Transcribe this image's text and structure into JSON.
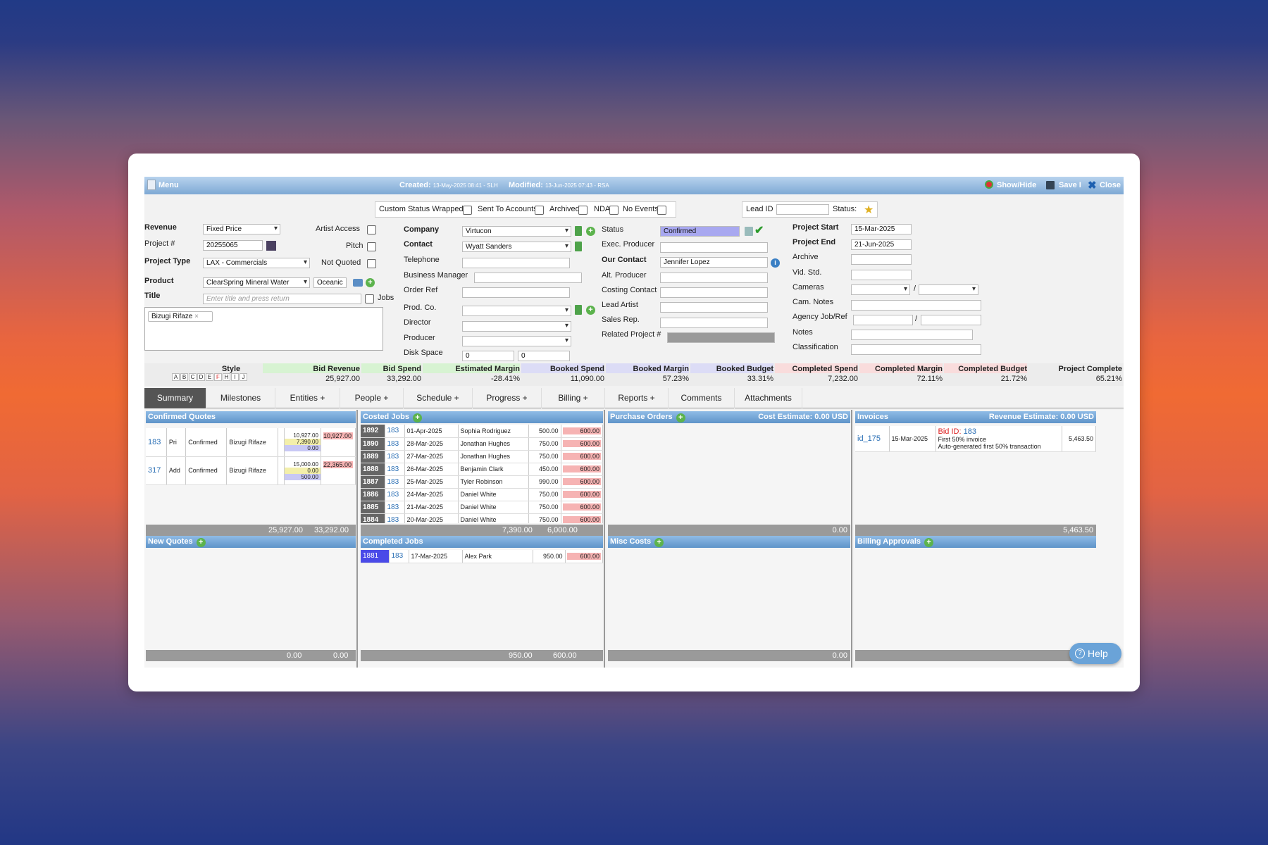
{
  "topbar": {
    "menu": "Menu",
    "created_label": "Created:",
    "created_value": "13-May-2025 08:41 - SLH",
    "modified_label": "Modified:",
    "modified_value": "13-Jun-2025 07:43 - RSA",
    "showhide": "Show/Hide",
    "save": "Save I",
    "close": "Close"
  },
  "flags": {
    "custom_status_wrapped": "Custom Status Wrapped",
    "sent_to_accounts": "Sent To Accounts",
    "archived": "Archived",
    "nda": "NDA",
    "no_events": "No Events",
    "lead_id": "Lead ID",
    "status": "Status:"
  },
  "left": {
    "revenue_label": "Revenue",
    "revenue_value": "Fixed Price",
    "project_label": "Project #",
    "project_value": "20255065",
    "project_type_label": "Project Type",
    "project_type_value": "LAX - Commercials",
    "product_label": "Product",
    "product_value": "ClearSpring Mineral Water",
    "product_tag": "Oceanic",
    "title_label": "Title",
    "title_placeholder": "Enter title and press return",
    "jobs": "Jobs",
    "tag": "Bizugi Rifaze",
    "artist_access": "Artist Access",
    "pitch": "Pitch",
    "not_quoted": "Not Quoted"
  },
  "mid": {
    "company_label": "Company",
    "company_value": "Virtucon",
    "contact_label": "Contact",
    "contact_value": "Wyatt Sanders",
    "telephone": "Telephone",
    "business_manager": "Business Manager",
    "order_ref": "Order Ref",
    "prod_co": "Prod. Co.",
    "director": "Director",
    "producer": "Producer",
    "disk_space": "Disk Space",
    "disk_a": "0",
    "disk_b": "0"
  },
  "right": {
    "status_label": "Status",
    "status_value": "Confirmed",
    "exec_producer": "Exec. Producer",
    "our_contact_label": "Our Contact",
    "our_contact_value": "Jennifer Lopez",
    "alt_producer": "Alt. Producer",
    "costing_contact": "Costing Contact",
    "lead_artist": "Lead Artist",
    "sales_rep": "Sales Rep.",
    "related_project": "Related Project #"
  },
  "far": {
    "project_start_label": "Project Start",
    "project_start_value": "15-Mar-2025",
    "project_end_label": "Project End",
    "project_end_value": "21-Jun-2025",
    "archive": "Archive",
    "vid_std": "Vid. Std.",
    "cameras": "Cameras",
    "cam_notes": "Cam. Notes",
    "agency": "Agency Job/Ref",
    "notes": "Notes",
    "classification": "Classification",
    "slash": "/"
  },
  "stats": {
    "style": "Style",
    "style_letters": [
      "A",
      "B",
      "C",
      "D",
      "E",
      "F",
      "H",
      "I",
      "J"
    ],
    "items": [
      {
        "label": "Bid Revenue",
        "value": "25,927.00",
        "color": "#d7f3d2"
      },
      {
        "label": "Bid Spend",
        "value": "33,292.00",
        "color": "#d7f3d2"
      },
      {
        "label": "Estimated Margin",
        "value": "-28.41%",
        "color": "#d7f3d2"
      },
      {
        "label": "Booked Spend",
        "value": "11,090.00",
        "color": "#dcdcf6"
      },
      {
        "label": "Booked Margin",
        "value": "57.23%",
        "color": "#dcdcf6"
      },
      {
        "label": "Booked Budget",
        "value": "33.31%",
        "color": "#dcdcf6"
      },
      {
        "label": "Completed Spend",
        "value": "7,232.00",
        "color": "#f9dcdc"
      },
      {
        "label": "Completed Margin",
        "value": "72.11%",
        "color": "#f9dcdc"
      },
      {
        "label": "Completed Budget",
        "value": "21.72%",
        "color": "#f9dcdc"
      },
      {
        "label": "Project Complete",
        "value": "65.21%",
        "color": "#ececec"
      }
    ]
  },
  "tabs": [
    "Summary",
    "Milestones",
    "Entities +",
    "People +",
    "Schedule +",
    "Progress +",
    "Billing +",
    "Reports +",
    "Comments",
    "Attachments"
  ],
  "quotes": {
    "title": "Confirmed Quotes",
    "rows": [
      {
        "id": "183",
        "type": "Pri",
        "status": "Confirmed",
        "client": "Bizugi Rifaze",
        "a": "10,927.00",
        "b": "7,390.00",
        "c": "0.00",
        "d": "10,927.00"
      },
      {
        "id": "317",
        "type": "Add",
        "status": "Confirmed",
        "client": "Bizugi Rifaze",
        "a": "15,000.00",
        "b": "0.00",
        "c": "500.00",
        "d": "22,365.00"
      }
    ],
    "foot_a": "25,927.00",
    "foot_b": "33,292.00",
    "new_title": "New Quotes",
    "new_foot_a": "0.00",
    "new_foot_b": "0.00"
  },
  "costed": {
    "title": "Costed Jobs",
    "rows": [
      [
        "1892",
        "183",
        "01-Apr-2025",
        "Sophia Rodriguez",
        "500.00",
        "600.00"
      ],
      [
        "1890",
        "183",
        "28-Mar-2025",
        "Jonathan Hughes",
        "750.00",
        "600.00"
      ],
      [
        "1889",
        "183",
        "27-Mar-2025",
        "Jonathan Hughes",
        "750.00",
        "600.00"
      ],
      [
        "1888",
        "183",
        "26-Mar-2025",
        "Benjamin Clark",
        "450.00",
        "600.00"
      ],
      [
        "1887",
        "183",
        "25-Mar-2025",
        "Tyler Robinson",
        "990.00",
        "600.00"
      ],
      [
        "1886",
        "183",
        "24-Mar-2025",
        "Daniel White",
        "750.00",
        "600.00"
      ],
      [
        "1885",
        "183",
        "21-Mar-2025",
        "Daniel White",
        "750.00",
        "600.00"
      ],
      [
        "1884",
        "183",
        "20-Mar-2025",
        "Daniel White",
        "750.00",
        "600.00"
      ]
    ],
    "foot_a": "7,390.00",
    "foot_b": "6,000.00",
    "completed_title": "Completed Jobs",
    "completed_row": [
      "1881",
      "183",
      "17-Mar-2025",
      "Alex Park",
      "950.00",
      "600.00"
    ],
    "completed_foot_a": "950.00",
    "completed_foot_b": "600.00"
  },
  "po": {
    "title": "Purchase Orders",
    "estimate": "Cost Estimate: 0.00 USD",
    "foot": "0.00",
    "misc_title": "Misc Costs",
    "misc_foot": "0.00"
  },
  "invoices": {
    "title": "Invoices",
    "estimate": "Revenue Estimate: 0.00 USD",
    "id": "id_175",
    "date": "15-Mar-2025",
    "bid_label": "Bid ID:",
    "bid_value": "183",
    "line1": "First 50% invoice",
    "line2": "Auto-generated first 50% transaction",
    "amount": "5,463.50",
    "foot": "5,463.50",
    "billing_title": "Billing Approvals"
  },
  "help": "Help"
}
